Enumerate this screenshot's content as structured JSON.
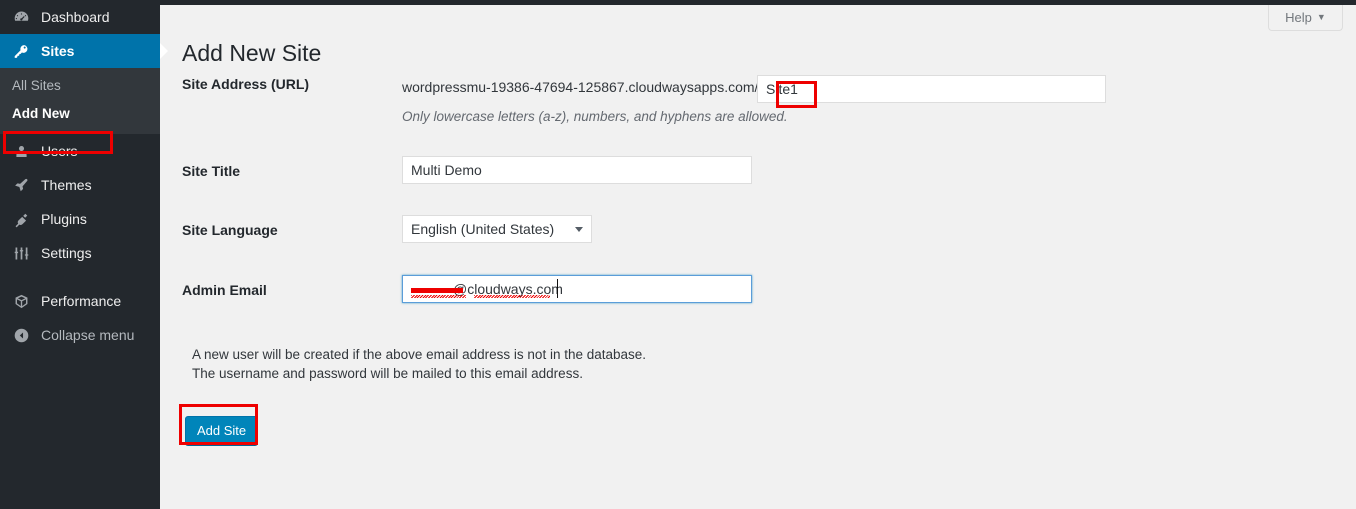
{
  "sidebar": {
    "items": [
      {
        "label": "Dashboard",
        "icon": "dashboard-icon",
        "active": false
      },
      {
        "label": "Sites",
        "icon": "key-icon",
        "active": true
      },
      {
        "label": "Users",
        "icon": "user-icon",
        "active": false
      },
      {
        "label": "Themes",
        "icon": "paintbrush-icon",
        "active": false
      },
      {
        "label": "Plugins",
        "icon": "plug-icon",
        "active": false
      },
      {
        "label": "Settings",
        "icon": "sliders-icon",
        "active": false
      },
      {
        "label": "Performance",
        "icon": "cube-icon",
        "active": false
      }
    ],
    "submenu": [
      {
        "label": "All Sites",
        "current": false
      },
      {
        "label": "Add New",
        "current": true
      }
    ],
    "collapse": {
      "label": "Collapse menu",
      "icon": "collapse-arrow-icon"
    },
    "colors": {
      "background": "#23282d",
      "submenu_background": "#32373c",
      "active": "#0073aa"
    }
  },
  "header": {
    "help_tab": {
      "label": "Help",
      "caret": "▼"
    },
    "page_title": "Add New Site"
  },
  "form": {
    "site_address": {
      "label": "Site Address (URL)",
      "prefix": "wordpressmu-19386-47694-125867.cloudwaysapps.com/",
      "value": "Site1",
      "placeholder": "",
      "description": "Only lowercase letters (a-z), numbers, and hyphens are allowed."
    },
    "site_title": {
      "label": "Site Title",
      "value": "Multi Demo",
      "placeholder": ""
    },
    "site_language": {
      "label": "Site Language",
      "value": "English (United States)",
      "caret": "▼"
    },
    "admin_email": {
      "label": "Admin Email",
      "value_visible": "@cloudways.com",
      "redacted": true,
      "placeholder": ""
    },
    "note_lines": [
      "A new user will be created if the above email address is not in the database.",
      "The username and password will be mailed to this email address."
    ],
    "submit": {
      "label": "Add Site",
      "color": "#0085ba"
    }
  },
  "annotations": {
    "color": "#ee0000",
    "boxes": [
      {
        "name": "add-new-highlight",
        "target": "Add New"
      },
      {
        "name": "site1-highlight",
        "target": "Site1"
      },
      {
        "name": "add-site-highlight",
        "target": "Add Site"
      }
    ]
  }
}
